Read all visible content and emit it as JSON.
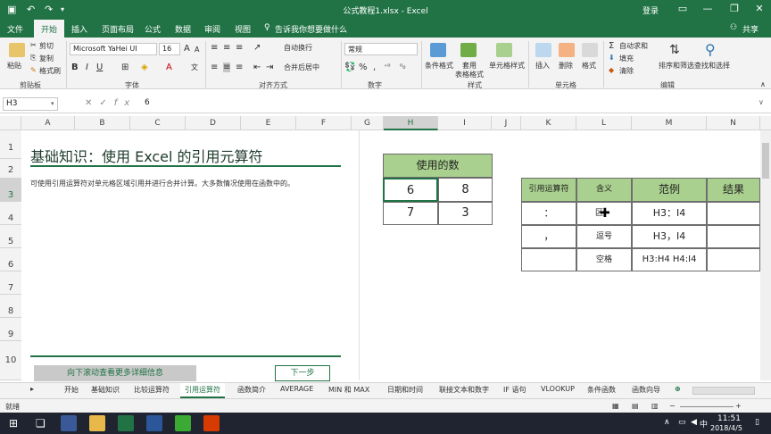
{
  "titlebar": {
    "title": "公式教程1.xlsx  -  Excel",
    "login": "登录"
  },
  "ribbon_tabs": [
    "文件",
    "开始",
    "插入",
    "页面布局",
    "公式",
    "数据",
    "审阅",
    "视图"
  ],
  "tell_me": "告诉我你想要做什么",
  "share": "共享",
  "ribbon": {
    "clipboard": {
      "paste": "粘贴",
      "cut": "剪切",
      "copy": "复制",
      "format_painter": "格式刷",
      "group": "剪贴板"
    },
    "font": {
      "name": "Microsoft YaHei UI",
      "size": "16",
      "group": "字体"
    },
    "alignment": {
      "wrap": "自动换行",
      "merge": "合并后居中",
      "group": "对齐方式"
    },
    "number": {
      "format": "常规",
      "group": "数字"
    },
    "styles": {
      "conditional": "条件格式",
      "table": "套用",
      "table2": "表格格式",
      "cell": "单元格样式",
      "group": "样式"
    },
    "cells": {
      "insert": "插入",
      "delete": "删除",
      "format": "格式",
      "group": "单元格"
    },
    "editing": {
      "autosum": "自动求和",
      "fill": "填充",
      "clear": "清除",
      "sort": "排序和筛选",
      "find": "查找和选择",
      "group": "编辑"
    }
  },
  "formula_bar": {
    "name_box": "H3",
    "value": "6"
  },
  "columns": [
    "A",
    "B",
    "C",
    "D",
    "E",
    "F",
    "G",
    "H",
    "I",
    "J",
    "K",
    "L",
    "M",
    "N"
  ],
  "rows": [
    "1",
    "2",
    "3",
    "4",
    "5",
    "6",
    "7",
    "8",
    "9",
    "10"
  ],
  "panel": {
    "title": "基础知识：使用 Excel 的引用元算符",
    "desc": "可使用引用运算符对单元格区域引用并进行合并计算。大多数情况使用在函数中的。",
    "scroll_btn": "向下滚动查看更多详细信息",
    "next_btn": "下一步"
  },
  "data_block": {
    "header": "使用的数",
    "values": [
      "6",
      "8",
      "7",
      "3"
    ]
  },
  "ref_table": {
    "headers": [
      "引用运算符",
      "含义",
      "范例",
      "结果"
    ],
    "rows": [
      {
        "op": "：",
        "meaning": "区",
        "example": "H3：I4",
        "result": ""
      },
      {
        "op": "，",
        "meaning": "逗号",
        "example": "H3，I4",
        "result": ""
      },
      {
        "op": "",
        "meaning": "空格",
        "example": "H3:H4 H4:I4",
        "result": ""
      }
    ]
  },
  "sheet_tabs": [
    "开始",
    "基础知识",
    "比较运算符",
    "引用运算符",
    "函数简介",
    "AVERAGE",
    "MIN 和 MAX",
    "日期和时间",
    "联接文本和数字",
    "IF 语句",
    "VLOOKUP",
    "条件函数",
    "函数向导"
  ],
  "active_sheet": "引用运算符",
  "status": "就绪",
  "clock": {
    "time": "11:51",
    "date": "2018/4/5"
  },
  "ime": "中",
  "colors": {
    "excel_green": "#217346",
    "header_green": "#a9d08e",
    "table_green": "#70ad47"
  }
}
